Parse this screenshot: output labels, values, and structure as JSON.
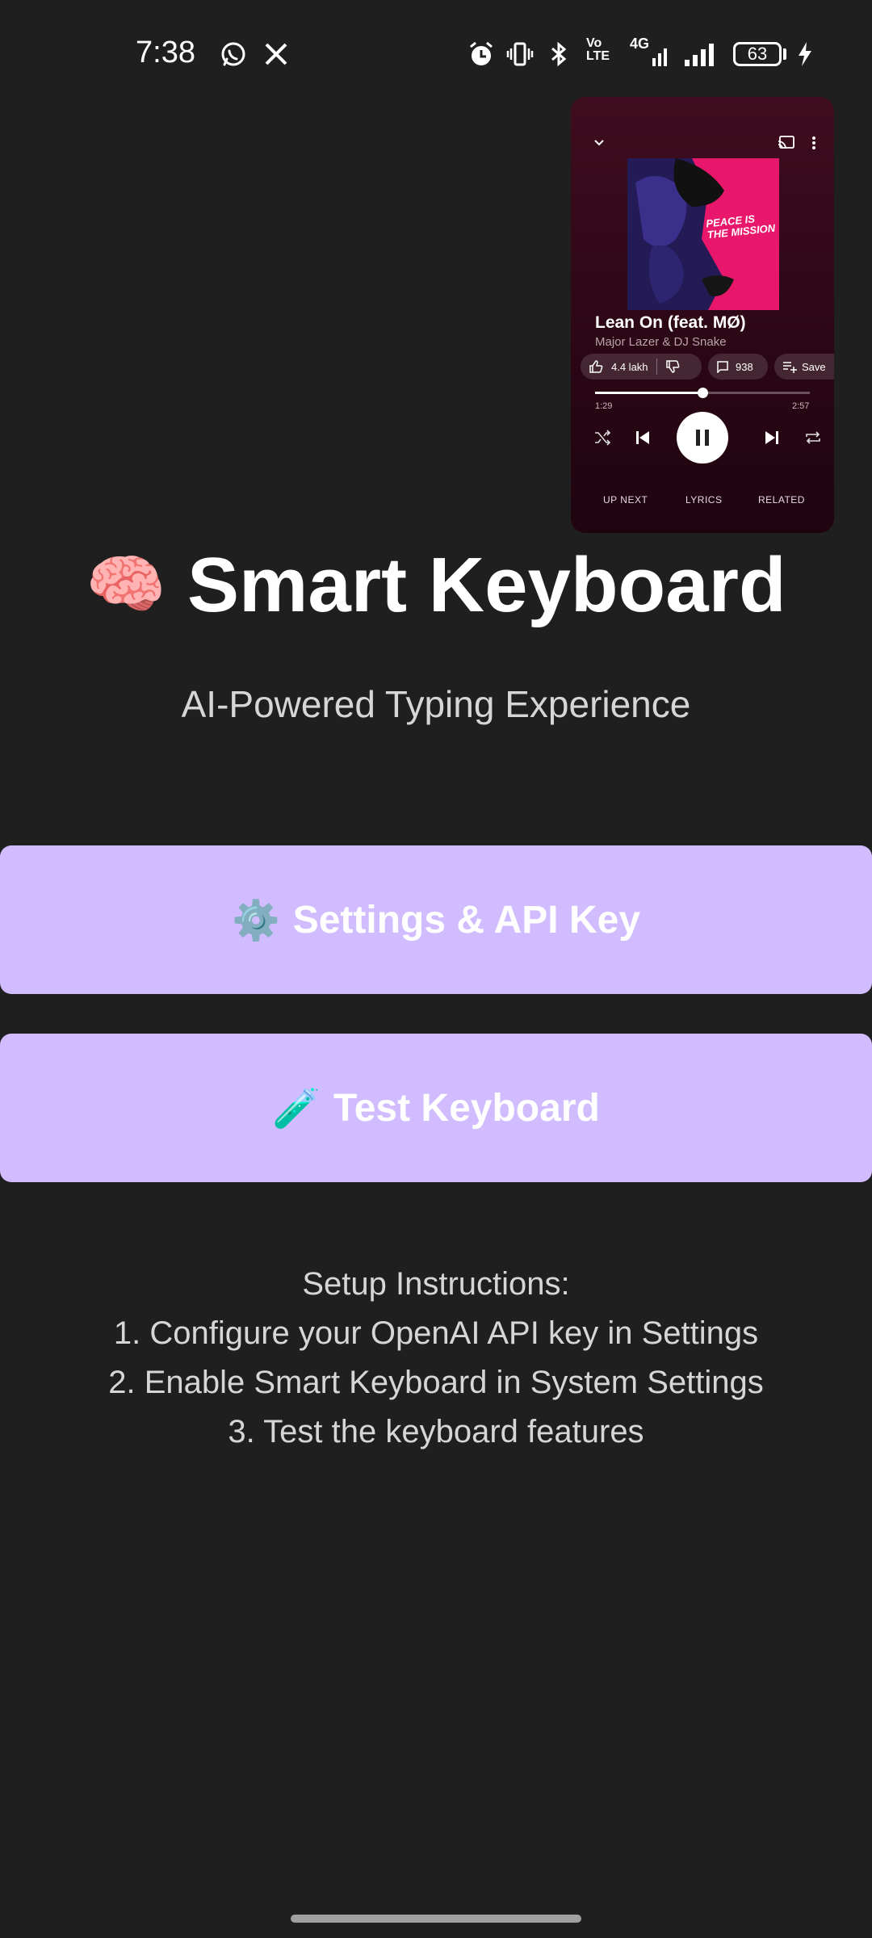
{
  "status_bar": {
    "time": "7:38",
    "icons": [
      "whatsapp-icon",
      "x-icon",
      "alarm-icon",
      "vibrate-icon",
      "bluetooth-icon",
      "volte-icon",
      "network-4g-icon",
      "signal-icon",
      "battery-icon",
      "charging-icon"
    ],
    "volte_label": "Vo LTE",
    "network_label": "4G",
    "battery_level": "63"
  },
  "mini_player": {
    "song_title": "Lean On (feat. MØ)",
    "artist": "Major Lazer & DJ Snake",
    "album_art_text": "PEACE IS THE MISSION",
    "likes": "4.4 lakh",
    "comments": "938",
    "save_label": "Save",
    "elapsed": "1:29",
    "duration": "2:57",
    "progress_fraction": 0.5,
    "tabs": [
      "UP NEXT",
      "LYRICS",
      "RELATED"
    ],
    "colors": {
      "background": "#3f0d1f",
      "album_art": "#e9176b"
    }
  },
  "app": {
    "title_emoji": "🧠",
    "title": "Smart Keyboard",
    "subtitle": "AI-Powered Typing Experience",
    "buttons": {
      "settings_emoji": "⚙️",
      "settings_label": "Settings & API Key",
      "test_emoji": "🧪",
      "test_label": "Test Keyboard"
    },
    "instructions": [
      "Setup Instructions:",
      "1. Configure your OpenAI API key in Settings",
      "2. Enable Smart Keyboard in System Settings",
      "3. Test the keyboard features"
    ],
    "colors": {
      "background": "#1f1f1f",
      "button": "#d0bcfe"
    }
  }
}
